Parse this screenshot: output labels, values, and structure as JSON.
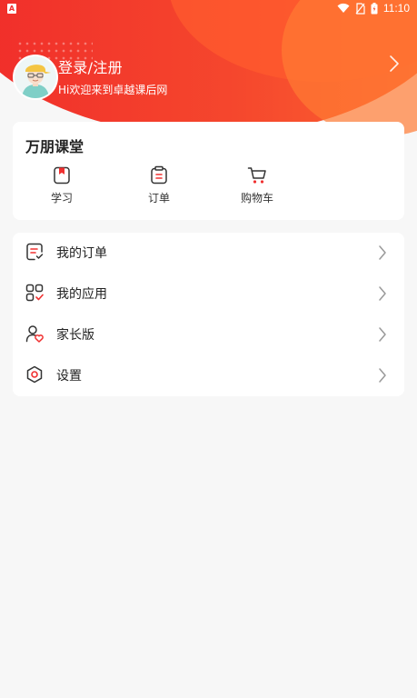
{
  "status_bar": {
    "left_badge": "A",
    "time": "11:10",
    "icons": [
      "wifi-icon",
      "no-sim-icon",
      "battery-icon"
    ]
  },
  "profile": {
    "title": "登录/注册",
    "subtitle": "Hi欢迎来到卓越课后网"
  },
  "classroom": {
    "title": "万朋课堂",
    "items": [
      {
        "label": "学习",
        "icon": "book-icon"
      },
      {
        "label": "订单",
        "icon": "order-icon"
      },
      {
        "label": "购物车",
        "icon": "cart-icon"
      }
    ]
  },
  "menu": {
    "items": [
      {
        "label": "我的订单",
        "icon": "order-list-icon"
      },
      {
        "label": "我的应用",
        "icon": "apps-icon"
      },
      {
        "label": "家长版",
        "icon": "parent-icon"
      },
      {
        "label": "设置",
        "icon": "settings-icon"
      }
    ]
  },
  "colors": {
    "brand": "#f02a2a",
    "accent_light": "#ff6a30",
    "background": "#f7f7f7"
  }
}
